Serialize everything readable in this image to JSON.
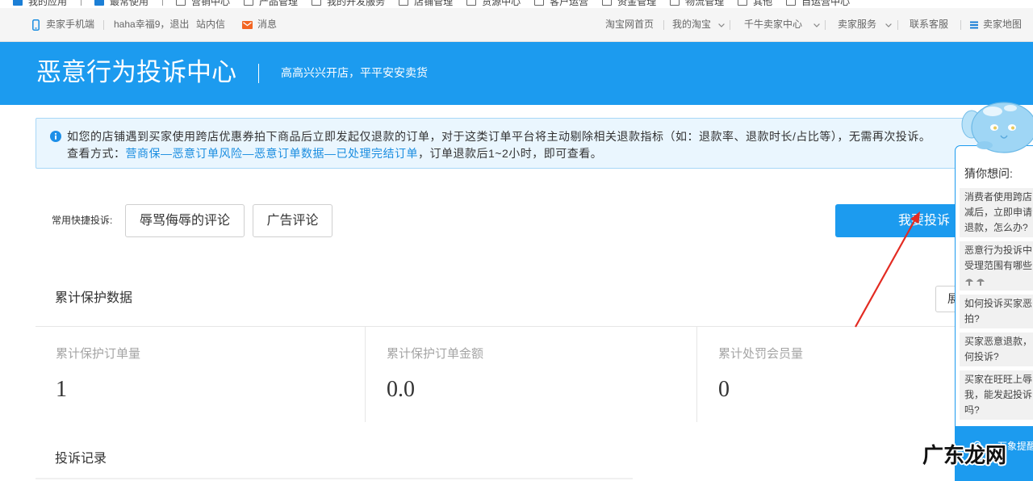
{
  "top_nav": {
    "items": [
      {
        "label": "我的应用",
        "icon": "app-icon"
      },
      {
        "label": "最常使用",
        "icon": "app-icon"
      },
      {
        "label": "营销中心",
        "icon": "folder-icon"
      },
      {
        "label": "产品管理",
        "icon": "folder-icon"
      },
      {
        "label": "我的开发服务",
        "icon": "folder-icon"
      },
      {
        "label": "店铺管理",
        "icon": "folder-icon"
      },
      {
        "label": "货源中心",
        "icon": "folder-icon"
      },
      {
        "label": "客户运营",
        "icon": "folder-icon"
      },
      {
        "label": "资金管理",
        "icon": "folder-icon"
      },
      {
        "label": "物流管理",
        "icon": "folder-icon"
      },
      {
        "label": "其他",
        "icon": "folder-icon"
      },
      {
        "label": "自运营中心",
        "icon": "folder-icon"
      }
    ]
  },
  "site_bar": {
    "mobile": "卖家手机端",
    "mobile_icon": "phone-icon",
    "user": "haha幸福9",
    "user_sep": "，",
    "logout": "退出",
    "inbox": "站内信",
    "messages": "消息",
    "messages_icon": "envelope-icon",
    "links": [
      {
        "label": "淘宝网首页"
      },
      {
        "label": "我的淘宝",
        "dropdown": true
      },
      {
        "label": "千牛卖家中心",
        "dropdown": true
      },
      {
        "label": "卖家服务",
        "dropdown": true
      },
      {
        "label": "联系客服"
      },
      {
        "label": "卖家地图",
        "icon": "menu-icon"
      }
    ]
  },
  "banner": {
    "title": "恶意行为投诉中心",
    "subtitle": "高高兴兴开店，平平安安卖货"
  },
  "notice": {
    "icon": "info-icon",
    "line1": "如您的店铺遇到买家使用跨店优惠券拍下商品后立即发起仅退款的订单，对于这类订单平台将主动剔除相关退款指标（如：退款率、退款时长/占比等），无需再次投诉。",
    "view_label": "查看方式：",
    "view_link": "营商保—恶意订单风险—恶意订单数据—已处理完结订单",
    "view_suffix": "，订单退款后1~2小时，即可查看。"
  },
  "quick_complaint": {
    "label": "常用快捷投诉:",
    "options": [
      "辱骂侮辱的评论",
      "广告评论"
    ],
    "submit": "我要投诉"
  },
  "protection": {
    "title": "累计保护数据",
    "toggle": "展",
    "stats": [
      {
        "label": "累计保护订单量",
        "value": "1"
      },
      {
        "label": "累计保护订单金额",
        "value": "0.0"
      },
      {
        "label": "累计处罚会员量",
        "value": "0"
      }
    ]
  },
  "records": {
    "title": "投诉记录"
  },
  "assistant": {
    "title": "猜你想问:",
    "questions": [
      {
        "lines": [
          "消费者使用跨店",
          "减后，立即申请",
          "退款，怎么办?"
        ]
      },
      {
        "lines": [
          "恶意行为投诉中",
          "受理范围有哪些"
        ],
        "icons": [
          "mushroom-emoji-icon",
          "mushroom-emoji-icon"
        ]
      },
      {
        "lines": [
          "如何投诉买家恶",
          "拍?"
        ]
      },
      {
        "lines": [
          "买家恶意退款，",
          "何投诉?"
        ]
      },
      {
        "lines": [
          "买家在旺旺上辱",
          "我，能发起投诉",
          "吗?"
        ]
      }
    ],
    "footer": "万象提醒",
    "footer_icon": "bell-icon",
    "mascot": "elephant-mascot-icon"
  },
  "watermark": "广东龙网",
  "colors": {
    "brand": "#1c9bef",
    "link": "#1a8de0",
    "notice_bg": "#eaf6fe",
    "annotation_arrow": "#e32b22",
    "envelope": "#f26522"
  }
}
